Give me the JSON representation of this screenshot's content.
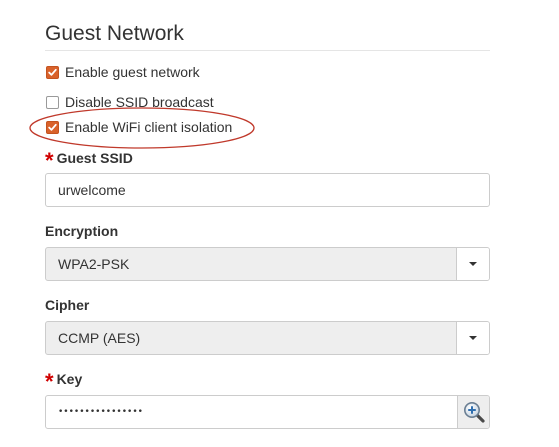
{
  "section": {
    "title": "Guest Network"
  },
  "options": {
    "enable_guest_network": {
      "label": "Enable guest network",
      "checked": true
    },
    "disable_ssid_broadcast": {
      "label": "Disable SSID broadcast",
      "checked": false
    },
    "enable_client_isolation": {
      "label": "Enable WiFi client isolation",
      "checked": true
    }
  },
  "guest_ssid": {
    "required_mark": "*",
    "label": "Guest SSID",
    "value": "urwelcome"
  },
  "encryption": {
    "label": "Encryption",
    "selected": "WPA2-PSK"
  },
  "cipher": {
    "label": "Cipher",
    "selected": "CCMP (AES)"
  },
  "key": {
    "required_mark": "*",
    "label": "Key",
    "masked_value": "••••••••••••••••",
    "reveal_icon": "magnifier-plus-icon"
  },
  "colors": {
    "checkbox_checked": "#d9622b",
    "required_star": "#d00000",
    "highlight_ellipse": "#c0392b"
  }
}
